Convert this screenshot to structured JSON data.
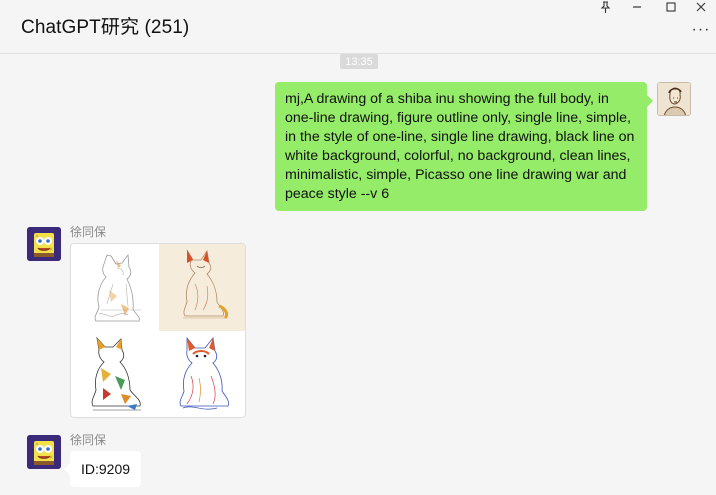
{
  "header": {
    "title": "ChatGPT研究 (251)",
    "pin_icon": "pin-icon",
    "minimize_icon": "minimize-icon",
    "maximize_icon": "maximize-icon",
    "close_icon": "close-icon",
    "more_icon": "more-icon"
  },
  "messages": [
    {
      "type": "timestamp",
      "text": "13:35"
    },
    {
      "type": "outgoing",
      "text": "mj,A drawing of a shiba inu showing the full body, in one-line drawing, figure outline only, single line, simple, in the style of one-line, single line drawing, black line on white background, colorful, no background, clean lines, minimalistic, simple, Picasso one line drawing war and peace style --v 6"
    },
    {
      "type": "incoming",
      "sender": "徐同保",
      "content": "image-grid",
      "images": [
        "shiba-line-drawing-1",
        "shiba-line-drawing-2",
        "shiba-line-drawing-3",
        "shiba-line-drawing-4"
      ]
    },
    {
      "type": "incoming",
      "sender": "徐同保",
      "text": "ID:9209"
    }
  ],
  "colors": {
    "background": "#f5f5f5",
    "outgoing_bubble": "#95ec69",
    "incoming_bubble": "#ffffff",
    "timestamp_bg": "#dadada",
    "sender_name": "#8a8a8a"
  }
}
